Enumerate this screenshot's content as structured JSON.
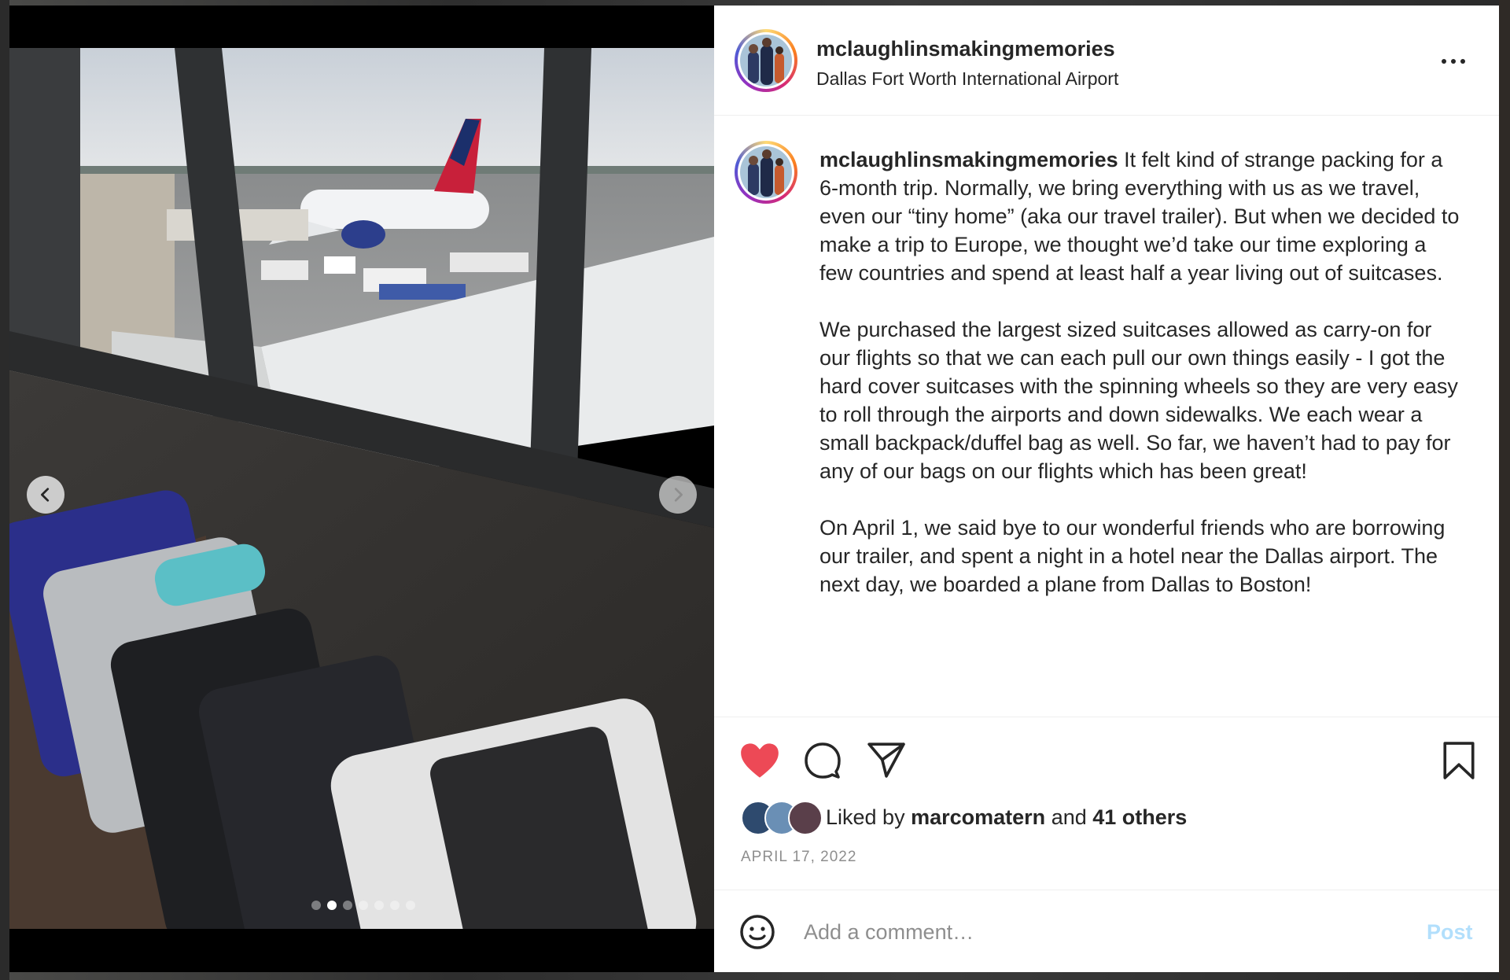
{
  "post": {
    "username": "mclaughlinsmakingmemories",
    "location": "Dallas Fort Worth International Airport",
    "caption_paragraphs": [
      "It felt kind of strange packing for a 6-month trip. Normally, we bring everything with us as we travel, even our “tiny home” (aka our travel trailer). But when we decided to make a trip to Europe, we thought we’d take our time exploring a few countries and spend at least half a year living out of suitcases.",
      "We purchased the largest sized suitcases allowed as carry-on for our flights so that we can each pull our own things easily - I got the hard cover suitcases with the spinning wheels so they are very easy to roll through the airports and down sidewalks. We each wear a small backpack/duffel bag as well. So far, we haven’t had to pay for any of our bags on our flights which has been great!",
      "On April 1, we said bye to our wonderful friends who are borrowing our trailer, and spent a night in a hotel near the Dallas airport. The next day, we boarded a plane from Dallas to Boston!"
    ],
    "likes_prefix": "Liked by",
    "liked_by_user": "marcomatern",
    "likes_and": "and",
    "likes_others": "41 others",
    "date": "APRIL 17, 2022"
  },
  "carousel": {
    "slide_count": 7,
    "active_index": 1
  },
  "comment_box": {
    "placeholder": "Add a comment…",
    "post_label": "Post"
  },
  "icons": [
    "more-options-icon",
    "chevron-left-icon",
    "chevron-right-icon",
    "heart-filled-icon",
    "comment-icon",
    "share-icon",
    "bookmark-icon",
    "emoji-icon"
  ],
  "colors": {
    "like_red": "#ed4956",
    "post_button_disabled": "#b2dffc",
    "meta_gray": "#8e8e8e",
    "text": "#262626"
  }
}
